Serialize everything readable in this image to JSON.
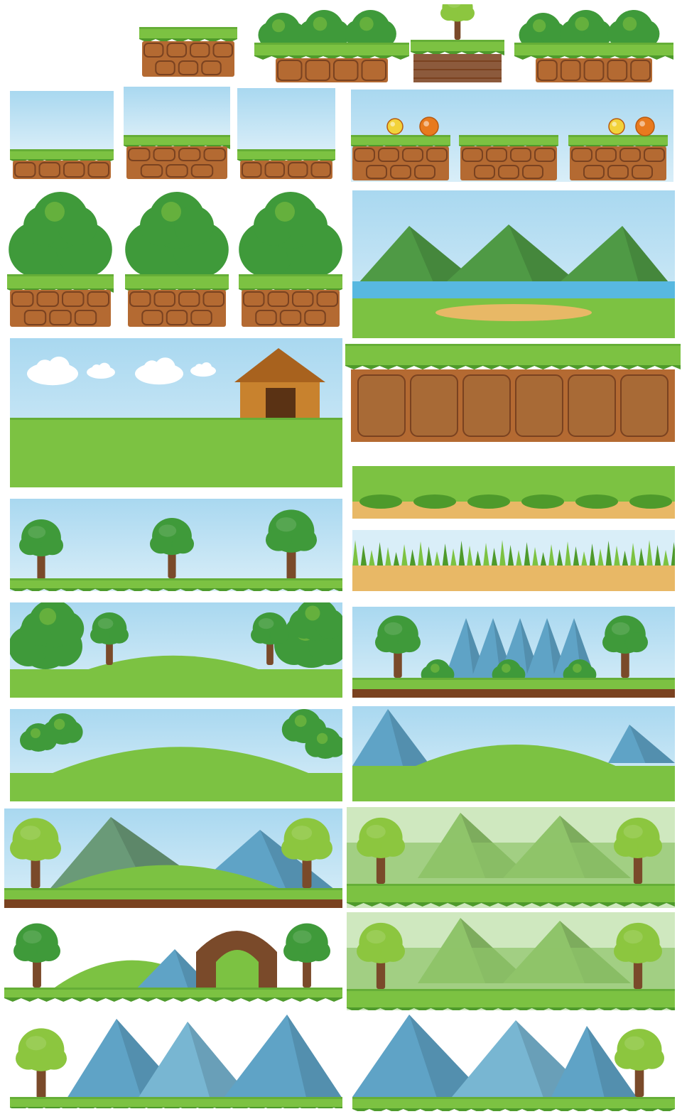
{
  "sheet": {
    "background": "#ffffff"
  },
  "palette": {
    "sky_top": "#a9d8f0",
    "sky_bottom": "#d9eef8",
    "grass_light": "#7cc242",
    "grass_dark": "#4e9a2b",
    "dirt": "#b46a32",
    "dirt_dark": "#7a4220",
    "stone": "#8c5a3c",
    "foliage": "#3f9a3a",
    "foliage_light": "#8cc63f",
    "trunk": "#7a4a2a",
    "mountain_green": "#4f9a45",
    "mountain_blue": "#5fa3c6",
    "water": "#58b8e0",
    "sand": "#e8b866",
    "coin_yellow": "#f2d23a",
    "coin_orange": "#e87a1e",
    "hut_wood": "#c8822e"
  },
  "tiles": [
    {
      "name": "dirt-block-small",
      "kind": "dirt-block"
    },
    {
      "name": "bush-platform-a",
      "kind": "bush-platform"
    },
    {
      "name": "tree-stone-platform",
      "kind": "tree-stone"
    },
    {
      "name": "bush-platform-b",
      "kind": "bush-platform"
    },
    {
      "name": "sky-grass-tile-a",
      "kind": "sky-strip"
    },
    {
      "name": "sky-dirt-tile",
      "kind": "sky-dirt"
    },
    {
      "name": "sky-grass-tile-b",
      "kind": "sky-strip"
    },
    {
      "name": "coin-platforms-strip",
      "kind": "coin-strip"
    },
    {
      "name": "tree-dirt-block-a",
      "kind": "tree-block"
    },
    {
      "name": "tree-dirt-block-b",
      "kind": "tree-block"
    },
    {
      "name": "tree-dirt-block-c",
      "kind": "tree-block"
    },
    {
      "name": "mountain-lake-scene",
      "kind": "lake"
    },
    {
      "name": "hut-meadow-scene",
      "kind": "hut"
    },
    {
      "name": "cliff-wall-tile",
      "kind": "cliff"
    },
    {
      "name": "grass-ledge-tile",
      "kind": "ledge"
    },
    {
      "name": "grass-sand-strip",
      "kind": "sand-grass"
    },
    {
      "name": "trees-row-scene",
      "kind": "trees-row"
    },
    {
      "name": "forest-hill-scene",
      "kind": "forest-hill"
    },
    {
      "name": "tree-mountain-scene",
      "kind": "tree-mountain"
    },
    {
      "name": "small-trees-hill-scene",
      "kind": "small-hill"
    },
    {
      "name": "mountain-hill-scene",
      "kind": "mountain-hill"
    },
    {
      "name": "trees-mountains-scene-a",
      "kind": "trees-mountains"
    },
    {
      "name": "trees-meadow-scene-a",
      "kind": "trees-meadow"
    },
    {
      "name": "cave-hill-scene",
      "kind": "cave"
    },
    {
      "name": "trees-meadow-scene-b",
      "kind": "trees-meadow"
    },
    {
      "name": "tree-blue-mountains-a",
      "kind": "blue-mountains"
    },
    {
      "name": "tree-blue-mountains-b",
      "kind": "blue-mountains-b"
    }
  ]
}
